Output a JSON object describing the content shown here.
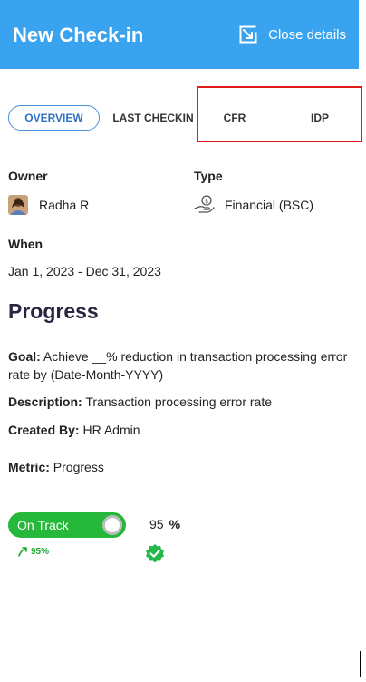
{
  "header": {
    "title": "New Check-in",
    "close_label": "Close details",
    "bg_color": "#39a3f0"
  },
  "tabs": [
    {
      "label": "OVERVIEW",
      "active": true
    },
    {
      "label": "LAST CHECKIN",
      "active": false
    },
    {
      "label": "CFR",
      "active": false
    },
    {
      "label": "IDP",
      "active": false
    }
  ],
  "details": {
    "owner_label": "Owner",
    "owner_name": "Radha R",
    "type_label": "Type",
    "type_value": "Financial (BSC)",
    "when_label": "When",
    "when_value": "Jan 1, 2023 - Dec 31, 2023"
  },
  "progress": {
    "section_title": "Progress",
    "goal_label": "Goal:",
    "goal_text": " Achieve __% reduction in transaction processing error rate by (Date-Month-YYYY)",
    "description_label": "Description:",
    "description_text": " Transaction processing error rate",
    "created_by_label": "Created By:",
    "created_by_text": " HR Admin",
    "metric_label": "Metric:",
    "metric_text": " Progress",
    "status_label": "On Track",
    "status_color": "#25b83a",
    "value": "95",
    "unit": "%",
    "trend_value": "95%"
  },
  "icons": {
    "close": "collapse-arrow-icon",
    "type": "hand-money-icon",
    "trend": "trend-up-arrow-icon",
    "check": "check-badge-icon"
  }
}
